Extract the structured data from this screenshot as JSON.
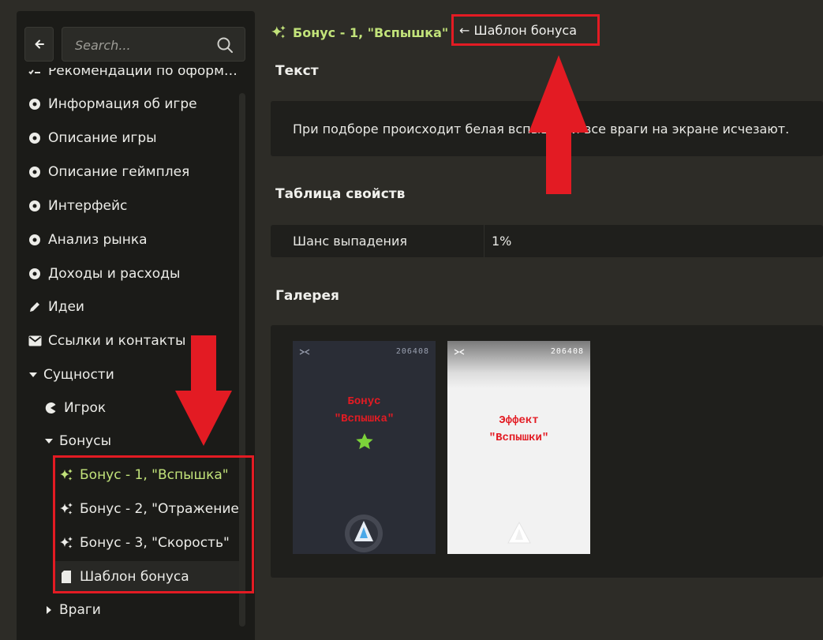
{
  "search": {
    "placeholder": "Search..."
  },
  "sidebar": {
    "items": [
      {
        "label": "Рекомендации по оформ…"
      },
      {
        "label": "Информация об игре"
      },
      {
        "label": "Описание игры"
      },
      {
        "label": "Описание геймплея"
      },
      {
        "label": "Интерфейс"
      },
      {
        "label": "Анализ рынка"
      },
      {
        "label": "Доходы и расходы"
      },
      {
        "label": "Идеи"
      },
      {
        "label": "Ссылки и контакты"
      },
      {
        "label": "Сущности"
      },
      {
        "label": "Игрок"
      },
      {
        "label": "Бонусы"
      },
      {
        "label": "Бонус - 1, \"Вспышка\""
      },
      {
        "label": "Бонус - 2, \"Отражение\""
      },
      {
        "label": "Бонус - 3, \"Скорость\""
      },
      {
        "label": "Шаблон бонуса"
      },
      {
        "label": "Враги"
      }
    ]
  },
  "page": {
    "title": "Бонус - 1, \"Вспышка\"",
    "template_annotation": "← Шаблон бонуса",
    "text_heading": "Текст",
    "text_body": "При подборе происходит белая вспышка и все враги на экране исчезают.",
    "props_heading": "Таблица свойств",
    "props": [
      {
        "key": "Шанс выпадения",
        "value": "1%"
      }
    ],
    "gallery_heading": "Галерея",
    "gallery": [
      {
        "score": "206408",
        "caption_line1": "Бонус",
        "caption_line2": "\"Вспышка\""
      },
      {
        "score": "206408",
        "caption_line1": "Эффект",
        "caption_line2": "\"Вспышки\""
      }
    ]
  },
  "colors": {
    "accent": "#c2e37a",
    "annotation_red": "#e31b23",
    "sidebar_bg": "#1b1b18",
    "content_bg": "#2d2c27"
  }
}
